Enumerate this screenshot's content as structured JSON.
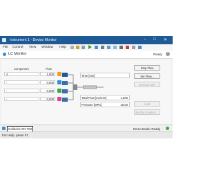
{
  "window": {
    "title": "Instrument 1 - Device Monitor"
  },
  "menu": {
    "items": [
      "File",
      "Control",
      "View",
      "Window",
      "Help"
    ]
  },
  "header": {
    "title": "LC Monitor",
    "status": "Ready"
  },
  "table": {
    "col_component": "Component",
    "col_flow": "Flow",
    "rows": [
      {
        "component": "A",
        "flow": "1,000",
        "color": "#f59a23"
      },
      {
        "component": "-",
        "flow": "0,000",
        "color": "#2f8fd8"
      },
      {
        "component": "-",
        "flow": "0,000",
        "color": "#39a845"
      },
      {
        "component": "-",
        "flow": "0,000",
        "color": "#e0409a"
      }
    ]
  },
  "readouts": {
    "time_label": "Time [min]",
    "total_flow_label": "Total Flow [mL/min]",
    "total_flow_value": "1,000",
    "pressure_label": "Pressure [MPa]",
    "pressure_value": "20,00"
  },
  "buttons": {
    "stop_flow": "Stop Flow",
    "set_flow": "Set Flow...",
    "execute_mix": "Execute Mix",
    "hold": "Hold",
    "modify_gradient": "Modify Gradient..."
  },
  "footer": {
    "device": "Colibrick SN 702",
    "mode": "Demo Mode: Ready"
  },
  "statusbar": {
    "text": "For Help, press F1"
  },
  "colors": {
    "titlebar": "#1e5a96",
    "stripe_accent": "#6aa5d8"
  }
}
